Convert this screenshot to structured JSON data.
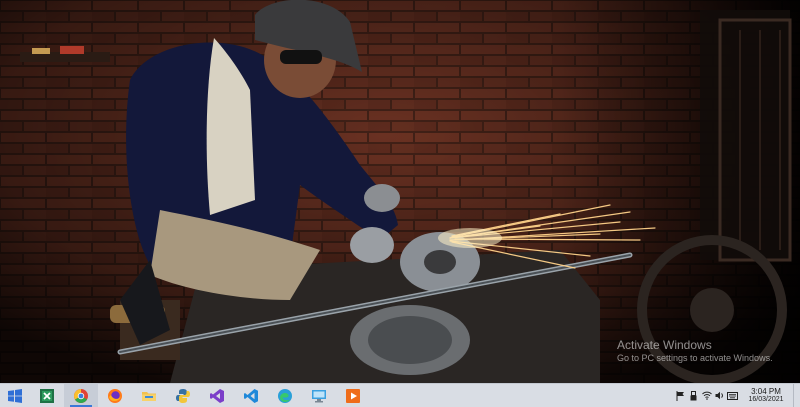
{
  "desktop": {
    "wallpaper": {
      "subject": "photo",
      "palette": {
        "brick": "#6b3222",
        "shadow": "#150d0a",
        "sparks": "#ffd28a"
      }
    },
    "watermark": {
      "title": "Activate Windows",
      "subtitle": "Go to PC settings to activate Windows."
    }
  },
  "taskbar": {
    "background": "#d9dde4",
    "start": {
      "icon": "windows-logo-icon",
      "color": "#2f6fd6"
    },
    "apps": [
      {
        "name": "excel",
        "icon": "excel-icon",
        "color": "#1e7145",
        "active": false,
        "running": false
      },
      {
        "name": "chrome",
        "icon": "chrome-icon",
        "color": "#e04436",
        "active": true,
        "running": true
      },
      {
        "name": "firefox",
        "icon": "firefox-icon",
        "color": "#ff7a1a",
        "active": false,
        "running": false
      },
      {
        "name": "file-explorer",
        "icon": "folder-icon",
        "color": "#f2c14e",
        "active": false,
        "running": false
      },
      {
        "name": "python",
        "icon": "python-icon",
        "color": "#3771a3",
        "active": false,
        "running": false
      },
      {
        "name": "visual-studio",
        "icon": "visual-studio-icon",
        "color": "#7b3ec9",
        "active": false,
        "running": false
      },
      {
        "name": "vs-code",
        "icon": "vscode-icon",
        "color": "#1f88d9",
        "active": false,
        "running": false
      },
      {
        "name": "edge",
        "icon": "edge-icon",
        "color": "#2aa0d8",
        "active": false,
        "running": false
      },
      {
        "name": "remote-desktop",
        "icon": "remote-desktop-icon",
        "color": "#3aa0e0",
        "active": false,
        "running": false
      },
      {
        "name": "media-player",
        "icon": "media-player-icon",
        "color": "#ef6c1a",
        "active": false,
        "running": false
      }
    ],
    "tray": {
      "icons": [
        "flag-icon",
        "usb-icon",
        "wifi-icon",
        "volume-icon",
        "keyboard-icon"
      ],
      "time": "3:04 PM",
      "date": "16/03/2021"
    }
  }
}
